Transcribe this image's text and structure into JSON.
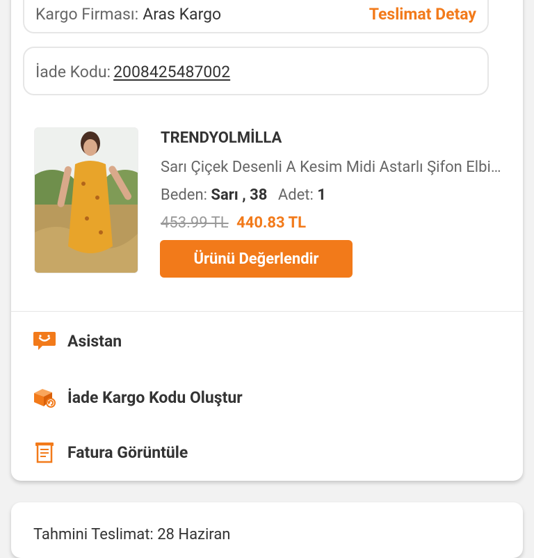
{
  "shipment": {
    "cargo_label": "Kargo Firması:",
    "cargo_value": "Aras Kargo",
    "detail_link": "Teslimat Detay"
  },
  "return_info": {
    "label": "İade Kodu:",
    "code": "2008425487002"
  },
  "product": {
    "brand": "TRENDYOLMİLLA",
    "name": "Sarı Çiçek Desenli A Kesim Midi Astarlı Şifon Elbise",
    "size_label": "Beden:",
    "size_value": "Sarı , 38",
    "qty_label": "Adet:",
    "qty_value": "1",
    "old_price": "453.99 TL",
    "new_price": "440.83 TL",
    "review_button": "Ürünü Değerlendir"
  },
  "actions": [
    {
      "label": "Asistan",
      "icon": "assistant-chat-icon"
    },
    {
      "label": "İade Kargo Kodu Oluştur",
      "icon": "return-box-icon"
    },
    {
      "label": "Fatura Görüntüle",
      "icon": "invoice-icon"
    }
  ],
  "next_card": {
    "text": "Tahmini Teslimat: 28 Haziran"
  },
  "colors": {
    "accent": "#f27a1a",
    "text": "#333333",
    "muted": "#666666",
    "background": "#f2f2f2"
  }
}
